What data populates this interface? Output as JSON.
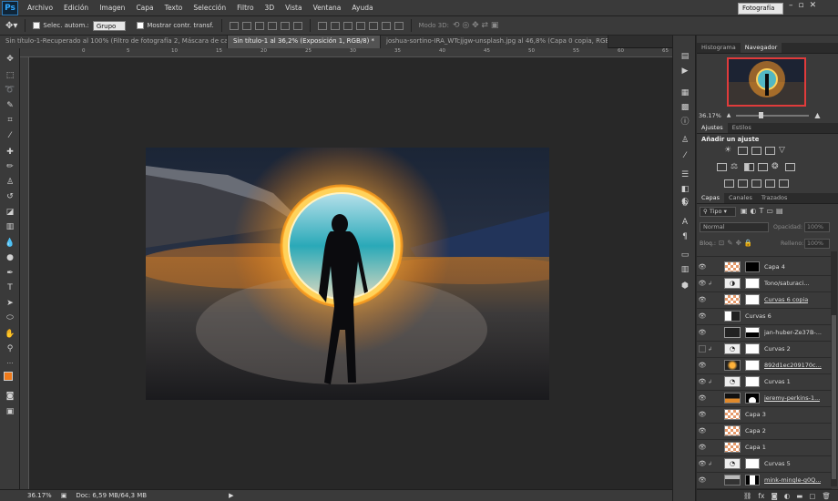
{
  "app": {
    "logo": "Ps",
    "workspace": "Fotografía",
    "window_controls": [
      "–",
      "▫",
      "✕"
    ]
  },
  "menu": [
    "Archivo",
    "Edición",
    "Imagen",
    "Capa",
    "Texto",
    "Selección",
    "Filtro",
    "3D",
    "Vista",
    "Ventana",
    "Ayuda"
  ],
  "options": {
    "auto_select_label": "Selec. autom.:",
    "auto_select_value": "Grupo",
    "show_transform_label": "Mostrar contr. transf.",
    "mode_3d_label": "Modo 3D:"
  },
  "tabs": [
    {
      "label": "Sin título-1-Recuperado al 100% (Filtro de fotografía 2, Máscara de cap...",
      "close": "✕"
    },
    {
      "label": "Sin título-1 al 36,2% (Exposición 1, RGB/8) *",
      "close": "✕"
    },
    {
      "label": "joshua-sortino-IRA_WTcjjgw-unsplash.jpg al 46,8% (Capa 0 copia, RGB...",
      "close": "✕"
    }
  ],
  "ruler": {
    "h_ticks": [
      "0",
      "5",
      "10",
      "15",
      "20",
      "25",
      "30",
      "35",
      "40",
      "45",
      "50",
      "55",
      "60",
      "65"
    ]
  },
  "status": {
    "zoom": "36.17%",
    "doc": "Doc: 6,59 MB/64,3 MB"
  },
  "navigator": {
    "tabs": [
      "Histograma",
      "Navegador"
    ],
    "zoom": "36.17%"
  },
  "adjustments": {
    "tabs": [
      "Ajustes",
      "Estilos"
    ],
    "title": "Añadir un ajuste"
  },
  "layers_panel": {
    "tabs": [
      "Capas",
      "Canales",
      "Trazados"
    ],
    "filter_kind": "Tipo",
    "blend_mode": "Normal",
    "opacity_label": "Opacidad:",
    "opacity_value": "100%",
    "lock_label": "Bloq.:",
    "fill_label": "Relleno:",
    "fill_value": "100%",
    "layers": [
      {
        "name": "Capa 4",
        "visible": true
      },
      {
        "name": "Tono/saturaci...",
        "visible": true
      },
      {
        "name": "Curvas 6 copia",
        "visible": true
      },
      {
        "name": "Curvas 6",
        "visible": true
      },
      {
        "name": "jan-huber-Ze37B-...",
        "visible": true
      },
      {
        "name": "Curvas 2",
        "visible": false
      },
      {
        "name": "892d1ec209170c...",
        "visible": true
      },
      {
        "name": "Curvas 1",
        "visible": true
      },
      {
        "name": "jeremy-perkins-1...",
        "visible": true
      },
      {
        "name": "Capa 3",
        "visible": true
      },
      {
        "name": "Capa 2",
        "visible": true
      },
      {
        "name": "Capa 1",
        "visible": true
      },
      {
        "name": "Curvas 5",
        "visible": true
      },
      {
        "name": "mink-mingle-g0Q...",
        "visible": true
      }
    ],
    "footer_icons": [
      "link-icon",
      "fx-icon",
      "mask-icon",
      "adjustment-icon",
      "folder-icon",
      "new-layer-icon",
      "trash-icon"
    ]
  }
}
